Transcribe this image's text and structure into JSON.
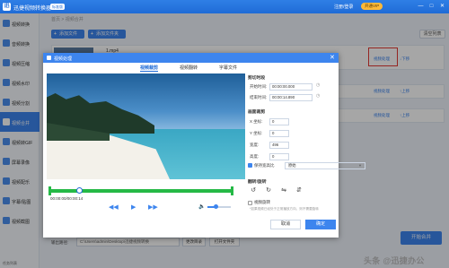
{
  "app": {
    "title": "迅捷视频转换器",
    "badge": "标准版",
    "login": "注册/登录",
    "vip": "开通VIP",
    "minimize": "—",
    "maximize": "□",
    "close": "✕"
  },
  "sidebar": {
    "items": [
      {
        "label": "视频转换"
      },
      {
        "label": "音频转换"
      },
      {
        "label": "视频压缩"
      },
      {
        "label": "视频水印"
      },
      {
        "label": "视频分割"
      },
      {
        "label": "视频合并"
      },
      {
        "label": "视频转GIF"
      },
      {
        "label": "屏幕录像"
      },
      {
        "label": "视频配乐"
      },
      {
        "label": "字幕/贴图"
      },
      {
        "label": "视频截图"
      }
    ],
    "active_index": 5
  },
  "main": {
    "breadcrumb": "首页 > 视频合并",
    "add_file": "添加文件",
    "add_folder": "添加文件夹",
    "sort": "清空列表",
    "file_name": "1.mp4",
    "edit_label": "视频处理",
    "down_label": "↓下移",
    "up_label": "↑上移",
    "output_label": "输出路径:",
    "output_path": "C:\\Users\\admin\\Desktop\\迅捷视频转换",
    "change_dir": "更改目录",
    "open_folder": "打开文件夹",
    "start": "开始合并",
    "footer": "任务列表",
    "watermark": "头条 @迅捷办公"
  },
  "modal": {
    "title": "视频处理",
    "close": "✕",
    "tabs": [
      "视频裁剪",
      "视频翻转",
      "字幕文件"
    ],
    "active_tab": 0,
    "time_readout": "00:00:00/00:00:14",
    "controls": {
      "prev": "◀◀",
      "play": "▶",
      "next": "▶▶",
      "volume_icon": "🔈"
    },
    "volume": 0.3,
    "segment": {
      "title": "剪切时段",
      "start_label": "开始时间:",
      "start_value": "00:00:00.000",
      "end_label": "结束时间:",
      "end_value": "00:00:14.890"
    },
    "crop": {
      "title": "画面裁剪",
      "x_label": "X 坐标:",
      "x_value": "0",
      "y_label": "Y 坐标:",
      "y_value": "0",
      "w_label": "宽度:",
      "w_value": "496",
      "h_label": "高度:",
      "h_value": "0",
      "keep_ratio": "保持宽高比",
      "ratio_value": "原始"
    },
    "rotate": {
      "title": "翻转/旋转",
      "icons": [
        "↺",
        "↻",
        "⇋",
        "⇵"
      ],
      "option": "视频旋转",
      "note": "*如果视频已经处于正常播放方向，则不需要旋转"
    },
    "cancel": "取消",
    "ok": "确定"
  }
}
